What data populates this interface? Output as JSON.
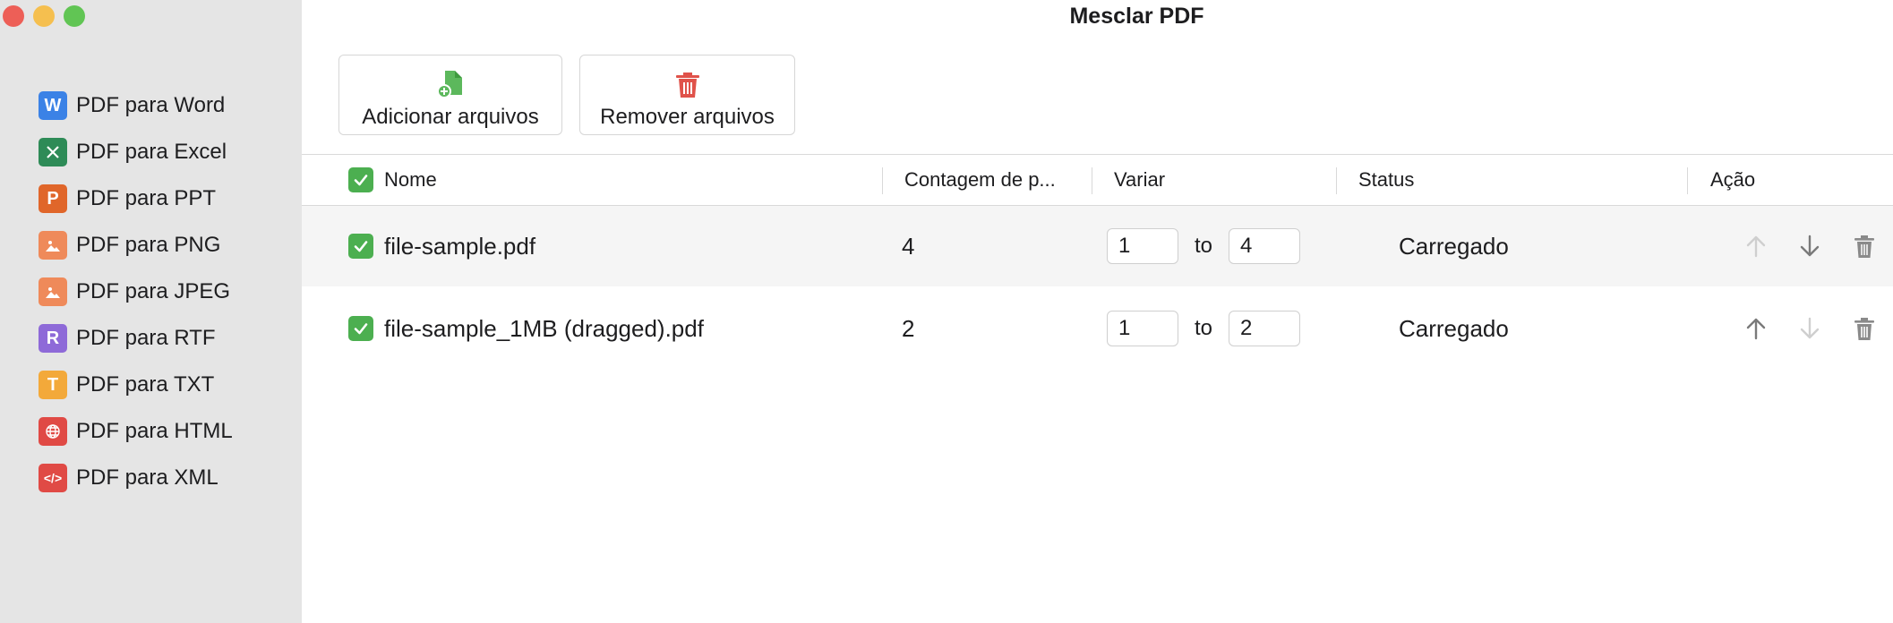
{
  "window": {
    "title": "Mesclar PDF"
  },
  "sidebar": {
    "items": [
      {
        "label": "PDF para Word",
        "icon": "word-icon",
        "glyph": "W",
        "color": "#3b82e6"
      },
      {
        "label": "PDF para Excel",
        "icon": "excel-icon",
        "glyph": "X",
        "color": "#2e8b57"
      },
      {
        "label": "PDF para PPT",
        "icon": "ppt-icon",
        "glyph": "P",
        "color": "#e0662a"
      },
      {
        "label": "PDF para PNG",
        "icon": "png-image-icon",
        "glyph": "",
        "color": "#ef8a5a"
      },
      {
        "label": "PDF para JPEG",
        "icon": "jpeg-image-icon",
        "glyph": "",
        "color": "#ef8a5a"
      },
      {
        "label": "PDF para RTF",
        "icon": "rtf-icon",
        "glyph": "R",
        "color": "#8e6ad8"
      },
      {
        "label": "PDF para TXT",
        "icon": "txt-icon",
        "glyph": "T",
        "color": "#f3a93a"
      },
      {
        "label": "PDF para HTML",
        "icon": "html-globe-icon",
        "glyph": "",
        "color": "#e04a45"
      },
      {
        "label": "PDF para XML",
        "icon": "xml-code-icon",
        "glyph": "</>",
        "color": "#e04a45"
      }
    ]
  },
  "toolbar": {
    "add_label": "Adicionar arquivos",
    "remove_label": "Remover arquivos"
  },
  "table": {
    "headers": {
      "name": "Nome",
      "page_count": "Contagem de p...",
      "range": "Variar",
      "status": "Status",
      "action": "Ação"
    },
    "range_separator": "to",
    "rows": [
      {
        "name": "file-sample.pdf",
        "page_count": "4",
        "range_from": "1",
        "range_to": "4",
        "status": "Carregado",
        "checked": true
      },
      {
        "name": "file-sample_1MB (dragged).pdf",
        "page_count": "2",
        "range_from": "1",
        "range_to": "2",
        "status": "Carregado",
        "checked": true
      }
    ]
  },
  "colors": {
    "check_green": "#4caf50",
    "add_icon_green": "#5cb85c",
    "trash_red": "#e0524a",
    "sidebar_bg": "#e5e5e5"
  }
}
